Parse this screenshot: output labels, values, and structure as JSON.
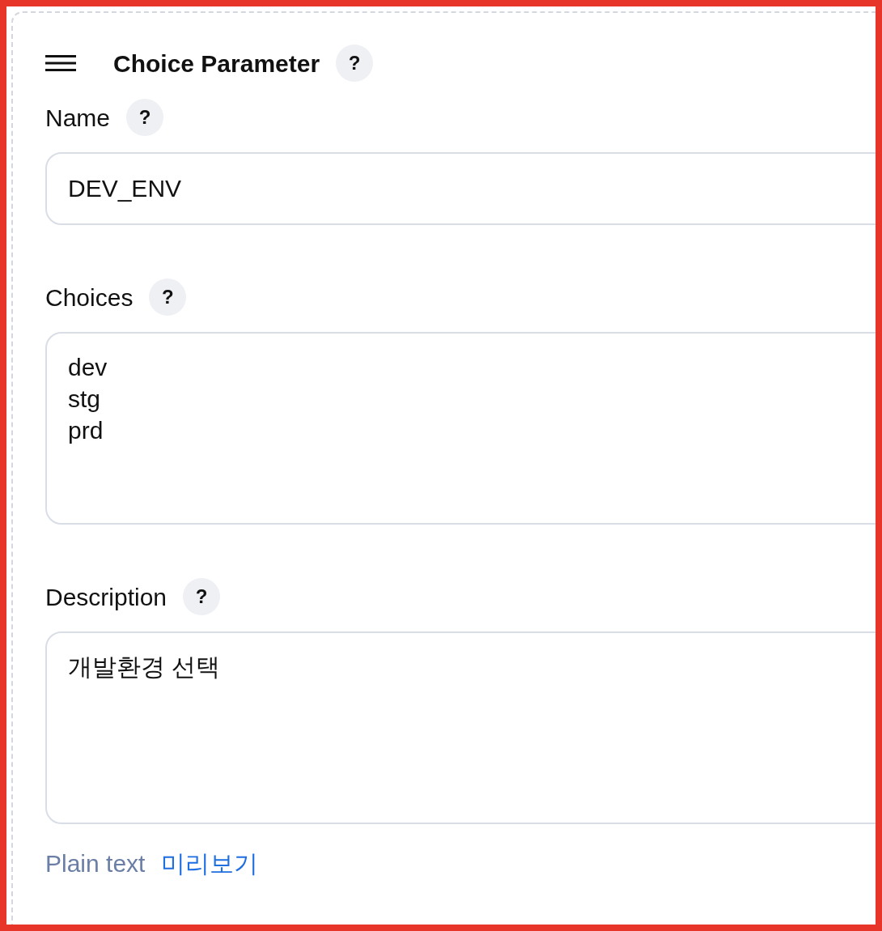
{
  "section": {
    "title": "Choice Parameter",
    "help": "?",
    "fields": [
      {
        "label": "Name",
        "help": "?",
        "kind": "input",
        "value": "DEV_ENV"
      },
      {
        "label": "Choices",
        "help": "?",
        "kind": "textarea",
        "value": "dev\nstg\nprd"
      },
      {
        "label": "Description",
        "help": "?",
        "kind": "textarea",
        "value": "개발환경 선택"
      }
    ],
    "format": {
      "label": "Plain text",
      "link": "미리보기"
    }
  }
}
